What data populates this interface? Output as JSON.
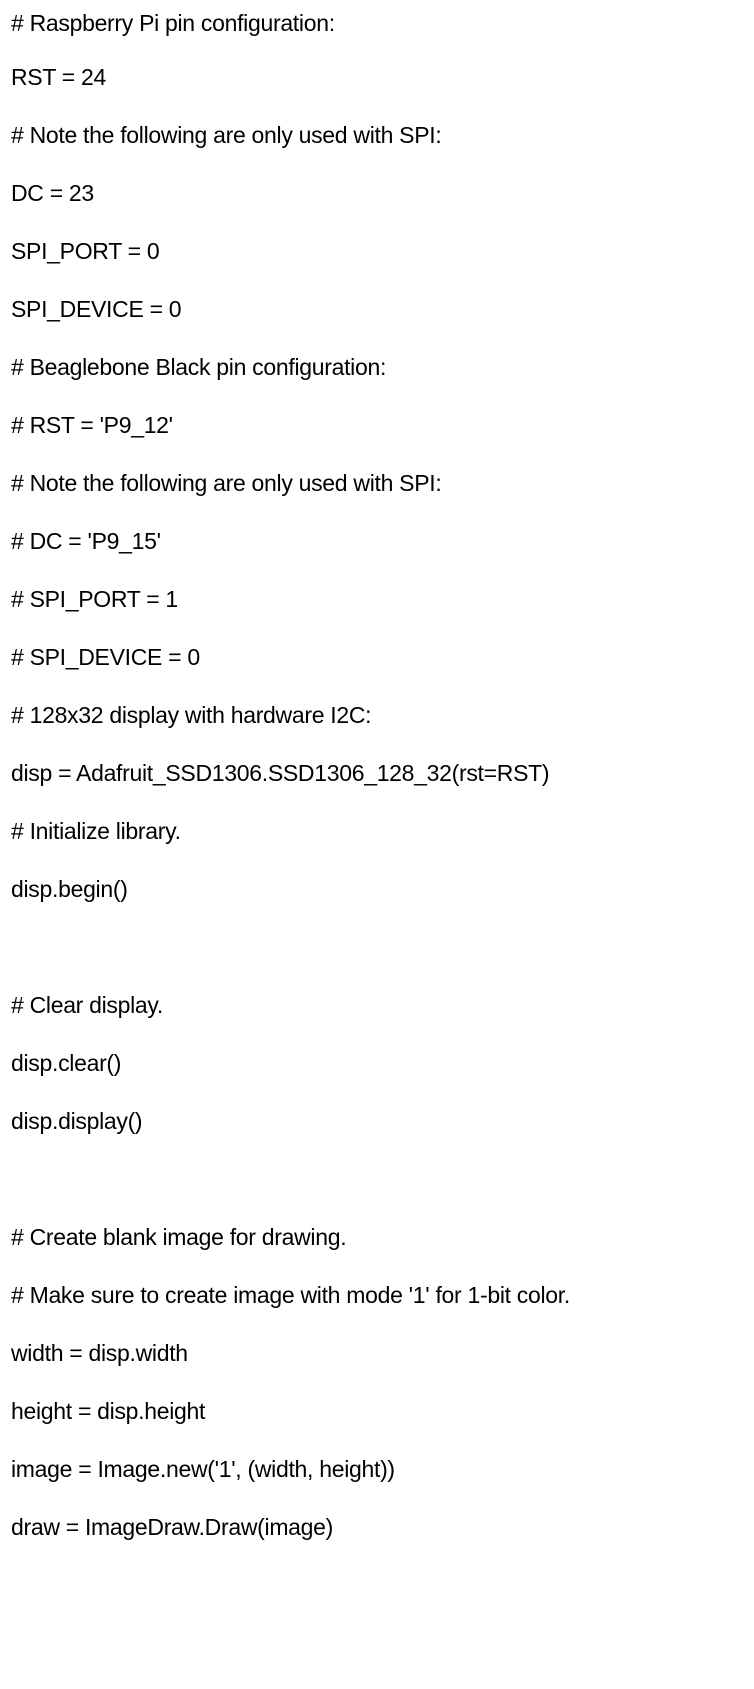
{
  "document": {
    "lines": [
      "# Raspberry Pi pin configuration:",
      "RST = 24",
      "# Note the following are only used with SPI:",
      "DC = 23",
      "SPI_PORT = 0",
      "SPI_DEVICE = 0",
      "# Beaglebone Black pin configuration:",
      "# RST = 'P9_12'",
      "# Note the following are only used with SPI:",
      "# DC = 'P9_15'",
      "# SPI_PORT = 1",
      "# SPI_DEVICE = 0",
      "# 128x32 display with hardware I2C:",
      "disp = Adafruit_SSD1306.SSD1306_128_32(rst=RST)",
      "# Initialize library.",
      "disp.begin()",
      "",
      "# Clear display.",
      "disp.clear()",
      "disp.display()",
      "",
      "# Create blank image for drawing.",
      "# Make sure to create image with mode '1' for 1-bit color.",
      "width = disp.width",
      "height = disp.height",
      "image = Image.new('1', (width, height))",
      "draw = ImageDraw.Draw(image)"
    ]
  }
}
